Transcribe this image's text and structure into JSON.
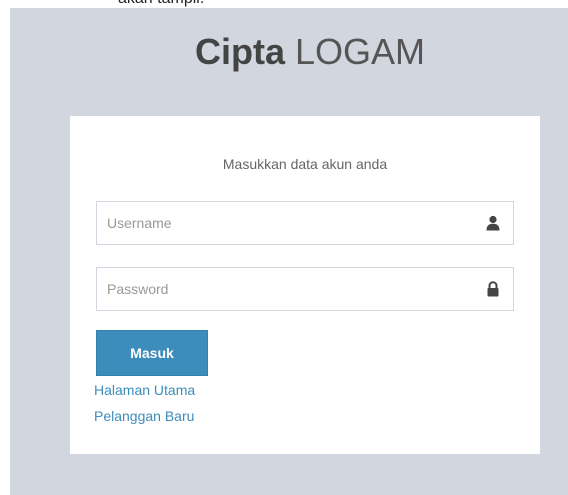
{
  "caption": "akan  tampil.",
  "logo": {
    "bold": "Cipta",
    "light": "LOGAM"
  },
  "login": {
    "message": "Masukkan data akun anda",
    "username_placeholder": "Username",
    "password_placeholder": "Password",
    "username_icon": "user-icon",
    "password_icon": "lock-icon",
    "submit_label": "Masuk",
    "link_home": "Halaman Utama",
    "link_new_customer": "Pelanggan Baru"
  },
  "colors": {
    "background": "#d2d6de",
    "primary": "#3c8dbc",
    "link": "#3c8dbc"
  }
}
